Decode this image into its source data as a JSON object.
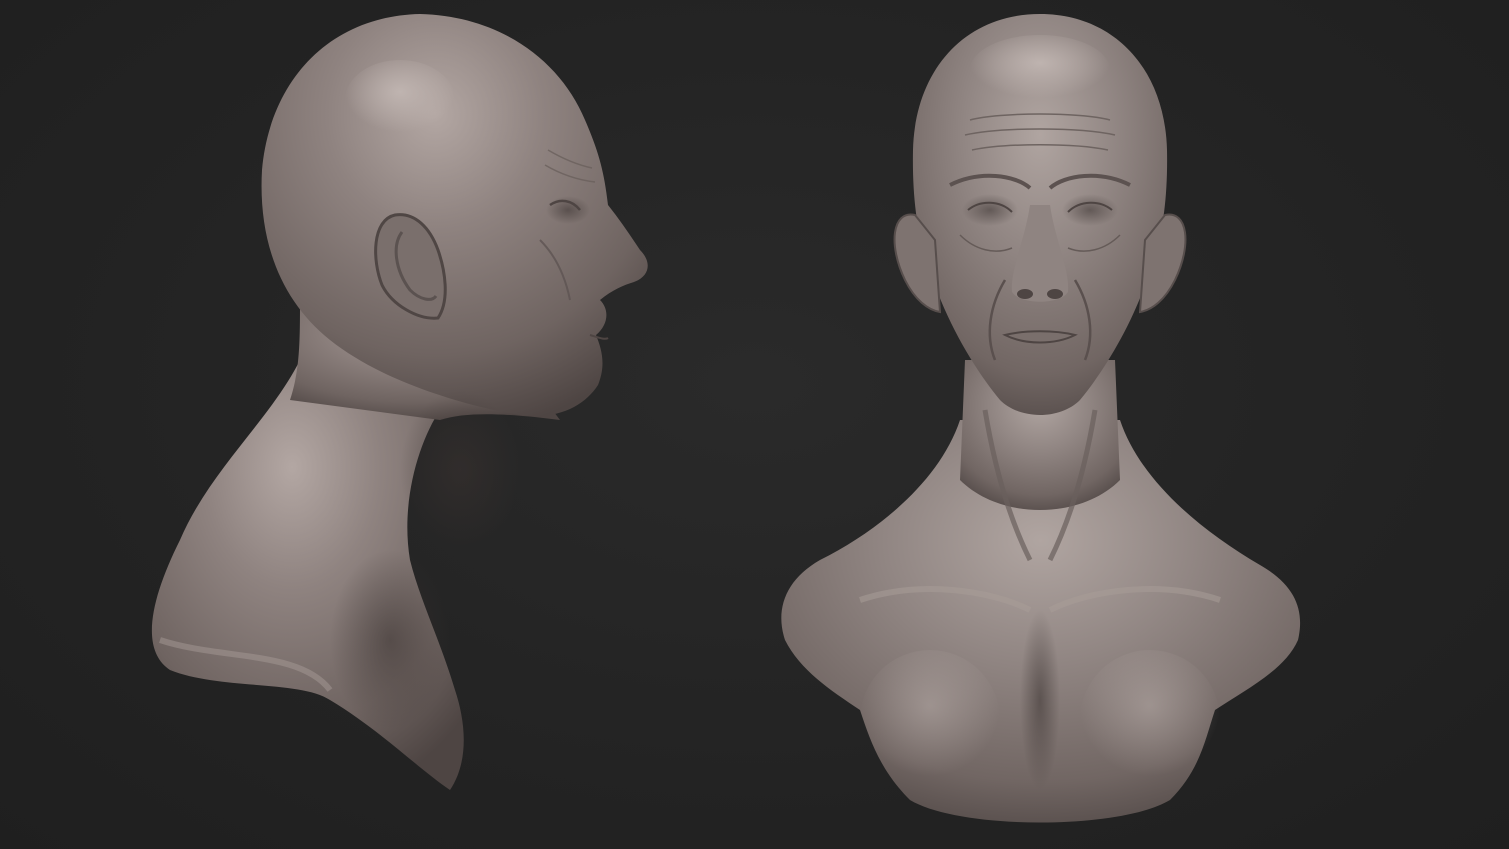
{
  "scene": {
    "background_color": "#232323",
    "material_color": "#8a7e7b",
    "highlight_color": "#b3a7a3",
    "shadow_color": "#4e4543"
  },
  "views": [
    {
      "name": "side-view",
      "icon": "sculpt-bust-side-profile"
    },
    {
      "name": "front-view",
      "icon": "sculpt-bust-front"
    }
  ]
}
